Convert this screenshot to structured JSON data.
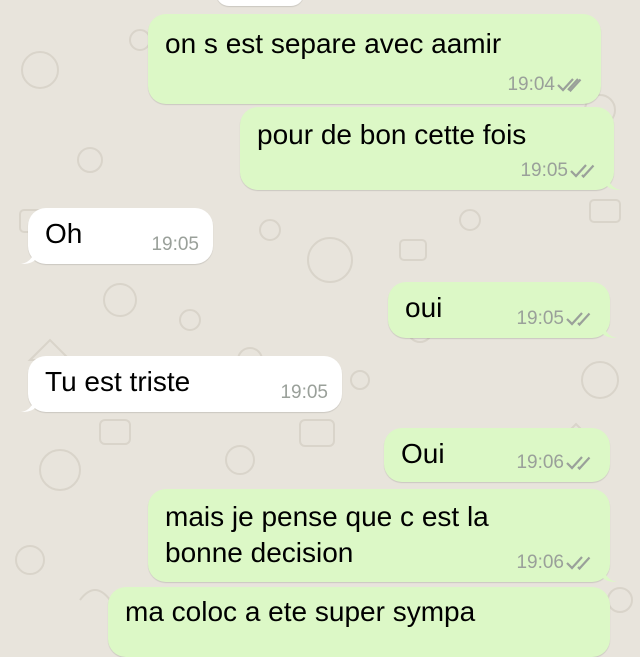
{
  "messages": [
    {
      "direction": "out",
      "text": "on s est separe avec aamir",
      "time": "19:04",
      "status": "read-ticks"
    },
    {
      "direction": "out",
      "text": "pour de bon cette fois",
      "time": "19:05",
      "status": "read-ticks"
    },
    {
      "direction": "in",
      "text": "Oh",
      "time": "19:05"
    },
    {
      "direction": "out",
      "text": "oui",
      "time": "19:05",
      "status": "read-ticks"
    },
    {
      "direction": "in",
      "text": "Tu est triste",
      "time": "19:05"
    },
    {
      "direction": "out",
      "text": "Oui",
      "time": "19:06",
      "status": "read-ticks"
    },
    {
      "direction": "out",
      "text_line1": "mais je pense que c est la",
      "text_line2": "bonne decision",
      "time": "19:06",
      "status": "read-ticks"
    },
    {
      "direction": "out",
      "text": "ma coloc a ete super sympa"
    }
  ],
  "colors": {
    "outgoing_bubble": "#dcf8c6",
    "incoming_bubble": "#ffffff",
    "background": "#e8e4dc",
    "timestamp": "#9aa09a",
    "ticks": "#9aa09a"
  },
  "icons": [
    "double-check-icon"
  ]
}
